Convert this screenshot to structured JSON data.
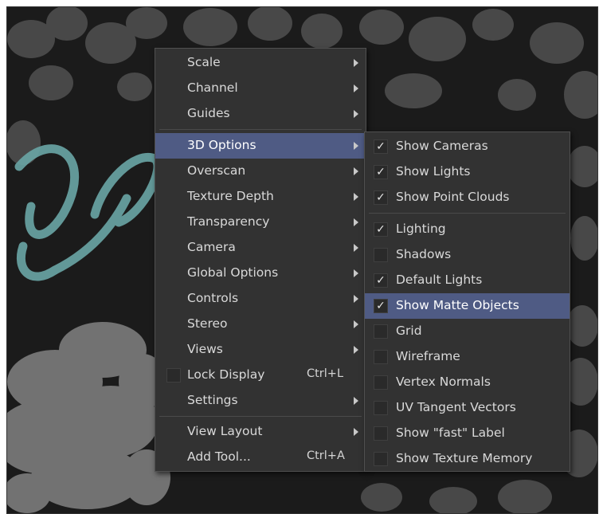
{
  "context_menu": {
    "items": [
      {
        "label": "Scale",
        "submenu": true
      },
      {
        "label": "Channel",
        "submenu": true
      },
      {
        "label": "Guides",
        "submenu": true
      },
      {
        "label": "3D Options",
        "submenu": true,
        "highlighted": true
      },
      {
        "label": "Overscan",
        "submenu": true
      },
      {
        "label": "Texture Depth",
        "submenu": true
      },
      {
        "label": "Transparency",
        "submenu": true
      },
      {
        "label": "Camera",
        "submenu": true
      },
      {
        "label": "Global Options",
        "submenu": true
      },
      {
        "label": "Controls",
        "submenu": true
      },
      {
        "label": "Stereo",
        "submenu": true
      },
      {
        "label": "Views",
        "submenu": true
      },
      {
        "label": "Lock Display",
        "shortcut": "Ctrl+L",
        "checkbox": true,
        "checked": false
      },
      {
        "label": "Settings",
        "submenu": true
      },
      {
        "label": "View Layout",
        "submenu": true
      },
      {
        "label": "Add Tool...",
        "shortcut": "Ctrl+A"
      }
    ]
  },
  "submenu_3d_options": {
    "check_glyph": "✓",
    "items": [
      {
        "label": "Show Cameras",
        "checked": true
      },
      {
        "label": "Show Lights",
        "checked": true
      },
      {
        "label": "Show Point Clouds",
        "checked": true
      },
      {
        "label": "Lighting",
        "checked": true
      },
      {
        "label": "Shadows",
        "checked": false
      },
      {
        "label": "Default Lights",
        "checked": true
      },
      {
        "label": "Show Matte Objects",
        "checked": true,
        "highlighted": true
      },
      {
        "label": "Grid",
        "checked": false
      },
      {
        "label": "Wireframe",
        "checked": false
      },
      {
        "label": "Vertex Normals",
        "checked": false
      },
      {
        "label": "UV Tangent Vectors",
        "checked": false
      },
      {
        "label": "Show \"fast\" Label",
        "checked": false
      },
      {
        "label": "Show Texture Memory",
        "checked": false
      }
    ]
  },
  "colors": {
    "menu_bg": "#323232",
    "highlight": "#4f5b84",
    "viewport_bg": "#1b1b1b",
    "script_text": "#5f9e9e"
  }
}
